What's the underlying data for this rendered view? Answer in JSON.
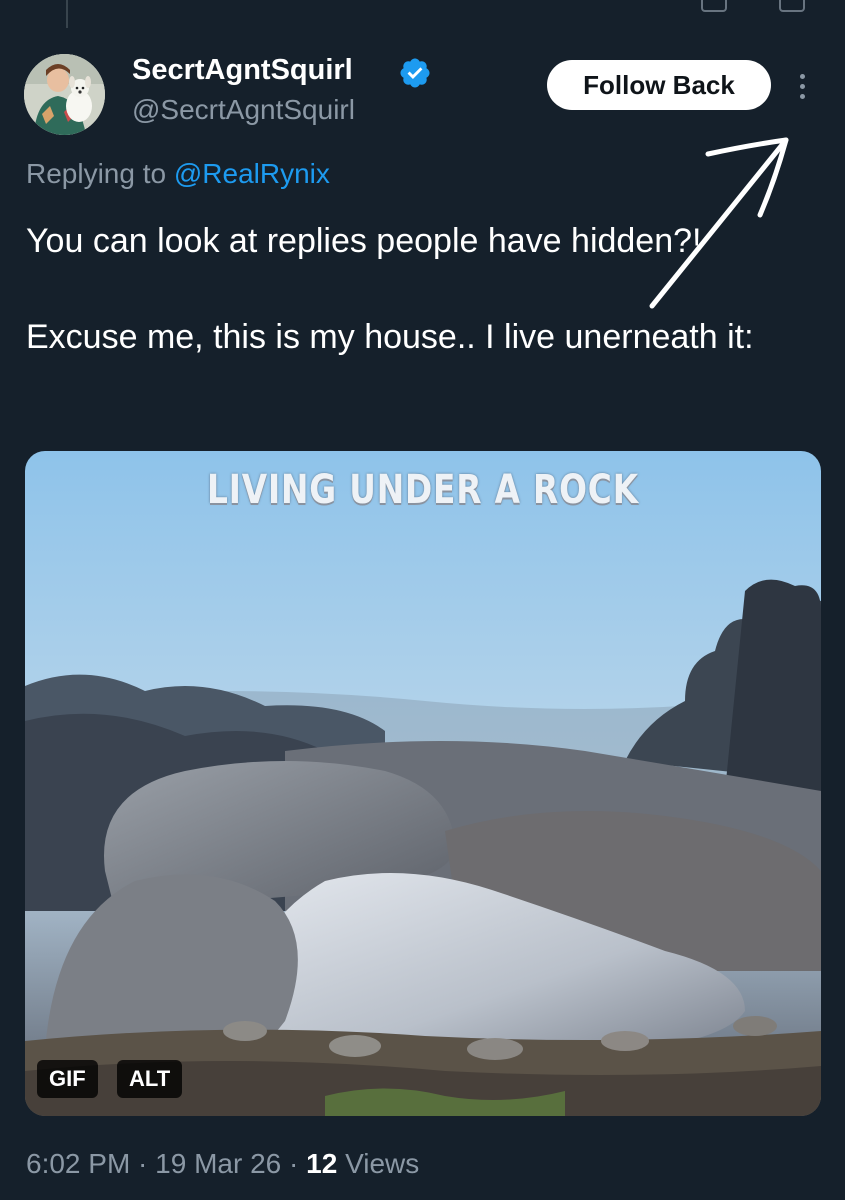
{
  "tweet": {
    "author": {
      "display_name": "SecrtAgntSquirl",
      "handle": "@SecrtAgntSquirl",
      "verified": true
    },
    "follow_button_label": "Follow Back",
    "more_icon": "more-vertical-icon",
    "reply": {
      "prefix": "Replying to ",
      "mention": "@RealRynix"
    },
    "text": {
      "paragraph_1": "You can look at replies people have hidden?!",
      "paragraph_2": "Excuse me, this is my house.. I live unerneath it:"
    },
    "media": {
      "caption": "LIVING UNDER A ROCK",
      "badges": {
        "gif": "GIF",
        "alt": "ALT"
      }
    },
    "meta": {
      "time": "6:02 PM",
      "separator": " · ",
      "date": "19 Mar 26",
      "views_count": "12",
      "views_label": " Views"
    }
  },
  "colors": {
    "background": "#15202b",
    "primary_text": "#ffffff",
    "secondary_text": "#8b98a5",
    "link": "#1d9bf0",
    "verified": "#1d9bf0"
  }
}
